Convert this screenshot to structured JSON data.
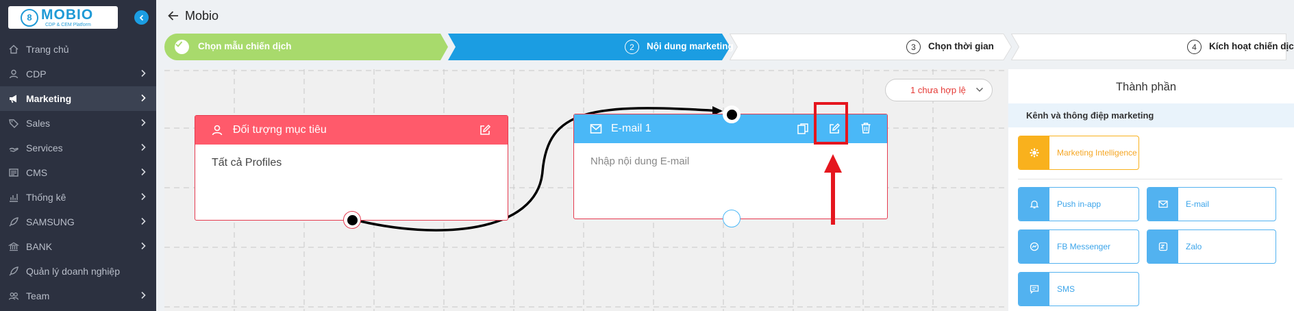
{
  "sidebar": {
    "logo": {
      "name": "MOBIO",
      "subtitle": "CDP & CEM Platform",
      "mark": "8"
    },
    "collapse_icon": "chevron-left-icon",
    "items": [
      {
        "label": "Trang chủ",
        "icon": "home-icon",
        "has_children": false,
        "active": false
      },
      {
        "label": "CDP",
        "icon": "user-icon",
        "has_children": true,
        "active": false
      },
      {
        "label": "Marketing",
        "icon": "megaphone-icon",
        "has_children": true,
        "active": true
      },
      {
        "label": "Sales",
        "icon": "tag-icon",
        "has_children": true,
        "active": false
      },
      {
        "label": "Services",
        "icon": "service-icon",
        "has_children": true,
        "active": false
      },
      {
        "label": "CMS",
        "icon": "cms-icon",
        "has_children": true,
        "active": false
      },
      {
        "label": "Thống kê",
        "icon": "chart-icon",
        "has_children": true,
        "active": false
      },
      {
        "label": "SAMSUNG",
        "icon": "rocket-icon",
        "has_children": true,
        "active": false
      },
      {
        "label": "BANK",
        "icon": "bank-icon",
        "has_children": true,
        "active": false
      },
      {
        "label": "Quản lý doanh nghiệp",
        "icon": "rocket-icon",
        "has_children": false,
        "active": false
      },
      {
        "label": "Team",
        "icon": "team-icon",
        "has_children": true,
        "active": false
      }
    ]
  },
  "header": {
    "title": "Mobio"
  },
  "stepper": {
    "steps": [
      {
        "number": "1",
        "label": "Chọn mẫu chiến dịch",
        "state": "done"
      },
      {
        "number": "2",
        "label": "Nội dung marketing",
        "state": "active"
      },
      {
        "number": "3",
        "label": "Chọn thời gian",
        "state": "todo"
      },
      {
        "number": "4",
        "label": "Kích hoạt chiến dịch",
        "state": "todo"
      }
    ]
  },
  "canvas": {
    "validity_label": "1 chưa hợp lệ",
    "nodes": {
      "target": {
        "title": "Đối tượng mục tiêu",
        "body": "Tất cả Profiles"
      },
      "email": {
        "title": "E-mail 1",
        "placeholder": "Nhập nội dung E-mail"
      }
    }
  },
  "panel": {
    "title": "Thành phần",
    "section_label": "Kênh và thông điệp marketing",
    "featured": {
      "label": "Marketing Intelligence",
      "icon": "gear-icon"
    },
    "channels": [
      {
        "label": "Push in-app",
        "icon": "bell-icon"
      },
      {
        "label": "E-mail",
        "icon": "mail-icon"
      },
      {
        "label": "FB Messenger",
        "icon": "messenger-icon"
      },
      {
        "label": "Zalo",
        "icon": "zalo-icon"
      },
      {
        "label": "SMS",
        "icon": "sms-icon"
      }
    ]
  },
  "colors": {
    "sidebar_bg": "#2c3140",
    "step_done": "#a8da6c",
    "step_active": "#1b9de2",
    "node_target": "#ff5a6b",
    "node_email": "#4ab8f7",
    "highlight": "#e5161e"
  }
}
